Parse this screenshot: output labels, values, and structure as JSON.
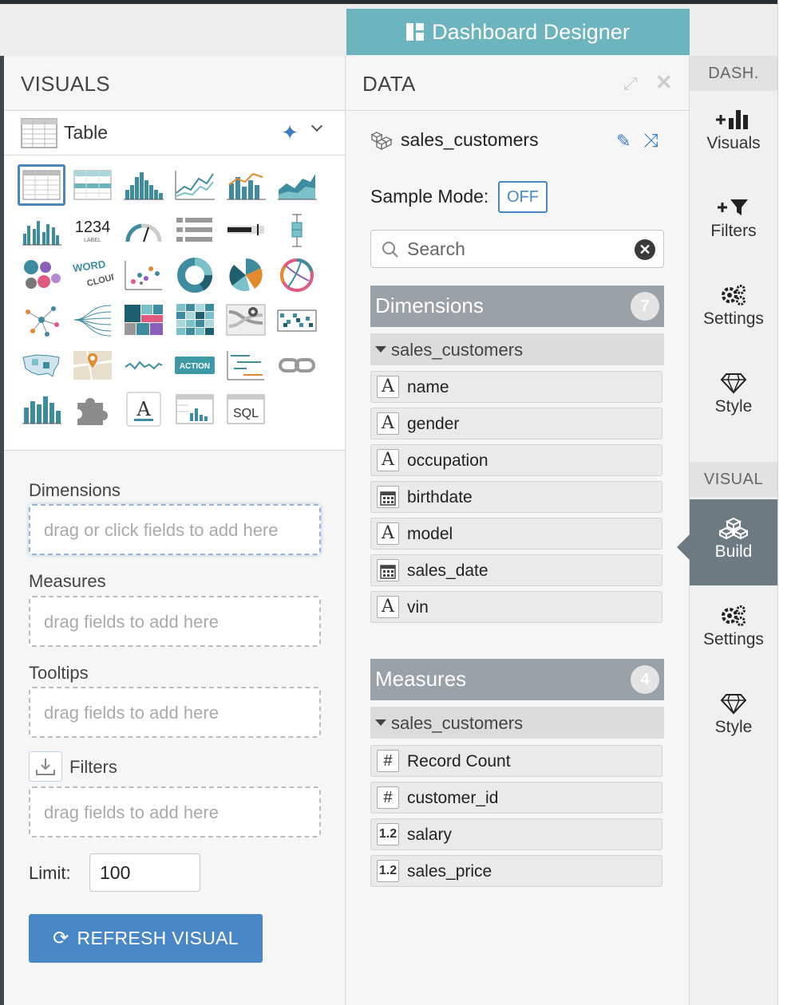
{
  "title_tab": {
    "label": "Dashboard Designer"
  },
  "visuals_panel": {
    "title": "VISUALS",
    "selected_type": "Table",
    "shelves": {
      "dimensions": {
        "label": "Dimensions",
        "placeholder": "drag or click fields to add here"
      },
      "measures": {
        "label": "Measures",
        "placeholder": "drag fields to add here"
      },
      "tooltips": {
        "label": "Tooltips",
        "placeholder": "drag fields to add here"
      },
      "filters": {
        "label": "Filters",
        "placeholder": "drag fields to add here"
      }
    },
    "limit_label": "Limit:",
    "limit_value": "100",
    "refresh_label": "REFRESH VISUAL",
    "icon_text": {
      "kpi_number": "1234",
      "kpi_sub": "LABEL",
      "word1": "WORD",
      "word2": "CLOUD",
      "action": "ACTION",
      "sql": "SQL"
    }
  },
  "data_panel": {
    "title": "DATA",
    "dataset": "sales_customers",
    "sample_mode_label": "Sample Mode:",
    "sample_mode_value": "OFF",
    "search_placeholder": "Search",
    "dimensions": {
      "title": "Dimensions",
      "count": "7",
      "group": "sales_customers",
      "fields": [
        {
          "icon": "A",
          "name": "name"
        },
        {
          "icon": "A",
          "name": "gender"
        },
        {
          "icon": "A",
          "name": "occupation"
        },
        {
          "icon": "calendar",
          "name": "birthdate"
        },
        {
          "icon": "A",
          "name": "model"
        },
        {
          "icon": "calendar",
          "name": "sales_date"
        },
        {
          "icon": "A",
          "name": "vin"
        }
      ]
    },
    "measures": {
      "title": "Measures",
      "count": "4",
      "group": "sales_customers",
      "fields": [
        {
          "icon": "#",
          "name": "Record Count"
        },
        {
          "icon": "#",
          "name": "customer_id"
        },
        {
          "icon": "1.2",
          "name": "salary"
        },
        {
          "icon": "1.2",
          "name": "sales_price"
        }
      ]
    }
  },
  "right_sidebar": {
    "dash_label": "DASH.",
    "visual_label": "VISUAL",
    "dash_items": [
      "Visuals",
      "Filters",
      "Settings",
      "Style"
    ],
    "visual_items": [
      "Build",
      "Settings",
      "Style"
    ]
  },
  "colors": {
    "accent": "#6cb5bf",
    "primary": "#4a87c6",
    "header_gray": "#9aa2a8",
    "active_nav": "#6e7a82"
  }
}
